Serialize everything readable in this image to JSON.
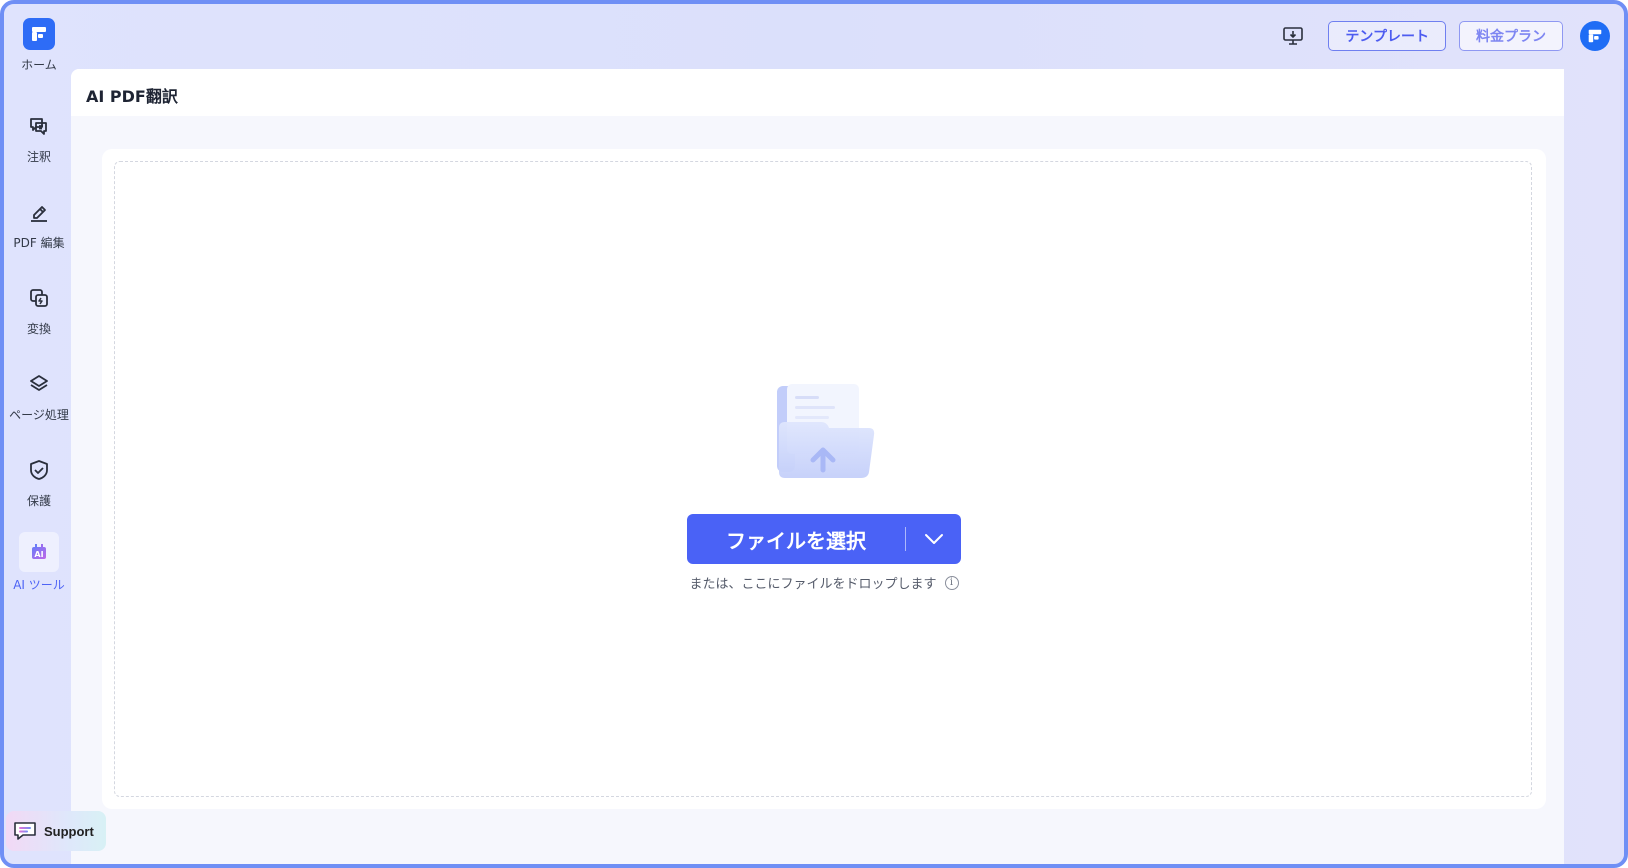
{
  "sidebar": {
    "items": [
      {
        "id": "home",
        "label": "ホーム",
        "icon": "home-logo-icon"
      },
      {
        "id": "annotate",
        "label": "注釈",
        "icon": "comment-edit-icon"
      },
      {
        "id": "pdf-edit",
        "label": "PDF 編集",
        "icon": "pen-edit-icon"
      },
      {
        "id": "convert",
        "label": "変換",
        "icon": "convert-icon"
      },
      {
        "id": "page",
        "label": "ページ処理",
        "icon": "layers-icon"
      },
      {
        "id": "protect",
        "label": "保護",
        "icon": "shield-check-icon"
      },
      {
        "id": "ai-tools",
        "label": "AI ツール",
        "icon": "ai-icon",
        "active": true
      }
    ],
    "support_label": "Support"
  },
  "topbar": {
    "template_label": "テンプレート",
    "plan_label": "料金プラン"
  },
  "main": {
    "title": "AI PDF翻訳",
    "select_button_label": "ファイルを選択",
    "drop_hint": "または、ここにファイルをドロップします",
    "info_glyph": "i"
  },
  "colors": {
    "accent": "#4a62f6",
    "brand": "#2e6cf6",
    "frame_border": "#6f8ff5"
  }
}
